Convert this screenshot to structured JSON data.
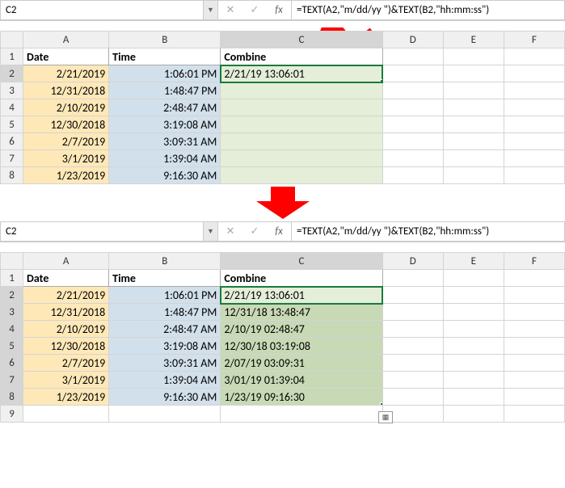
{
  "nameBox": "C2",
  "formula": "=TEXT(A2,\"m/dd/yy \")&TEXT(B2,\"hh:mm:ss\")",
  "columns": [
    "A",
    "B",
    "C",
    "D",
    "E",
    "F"
  ],
  "headers": {
    "date": "Date",
    "time": "Time",
    "combine": "Combine"
  },
  "rows": [
    {
      "n": 2,
      "date": "2/21/2019",
      "time": "1:06:01 PM",
      "combine": "2/21/19 13:06:01"
    },
    {
      "n": 3,
      "date": "12/31/2018",
      "time": "1:48:47 PM",
      "combine": "12/31/18 13:48:47"
    },
    {
      "n": 4,
      "date": "2/10/2019",
      "time": "2:48:47 AM",
      "combine": "2/10/19 02:48:47"
    },
    {
      "n": 5,
      "date": "12/30/2018",
      "time": "3:19:08 AM",
      "combine": "12/30/18 03:19:08"
    },
    {
      "n": 6,
      "date": "2/7/2019",
      "time": "3:09:31 AM",
      "combine": "2/07/19 03:09:31"
    },
    {
      "n": 7,
      "date": "3/1/2019",
      "time": "1:39:04 AM",
      "combine": "3/01/19 01:39:04"
    },
    {
      "n": 8,
      "date": "1/23/2019",
      "time": "9:16:30 AM",
      "combine": "1/23/19 09:16:30"
    }
  ],
  "icons": {
    "dropdown": "▼",
    "cancel": "✕",
    "check": "✓",
    "fx": "fx",
    "autofill": "▦"
  }
}
